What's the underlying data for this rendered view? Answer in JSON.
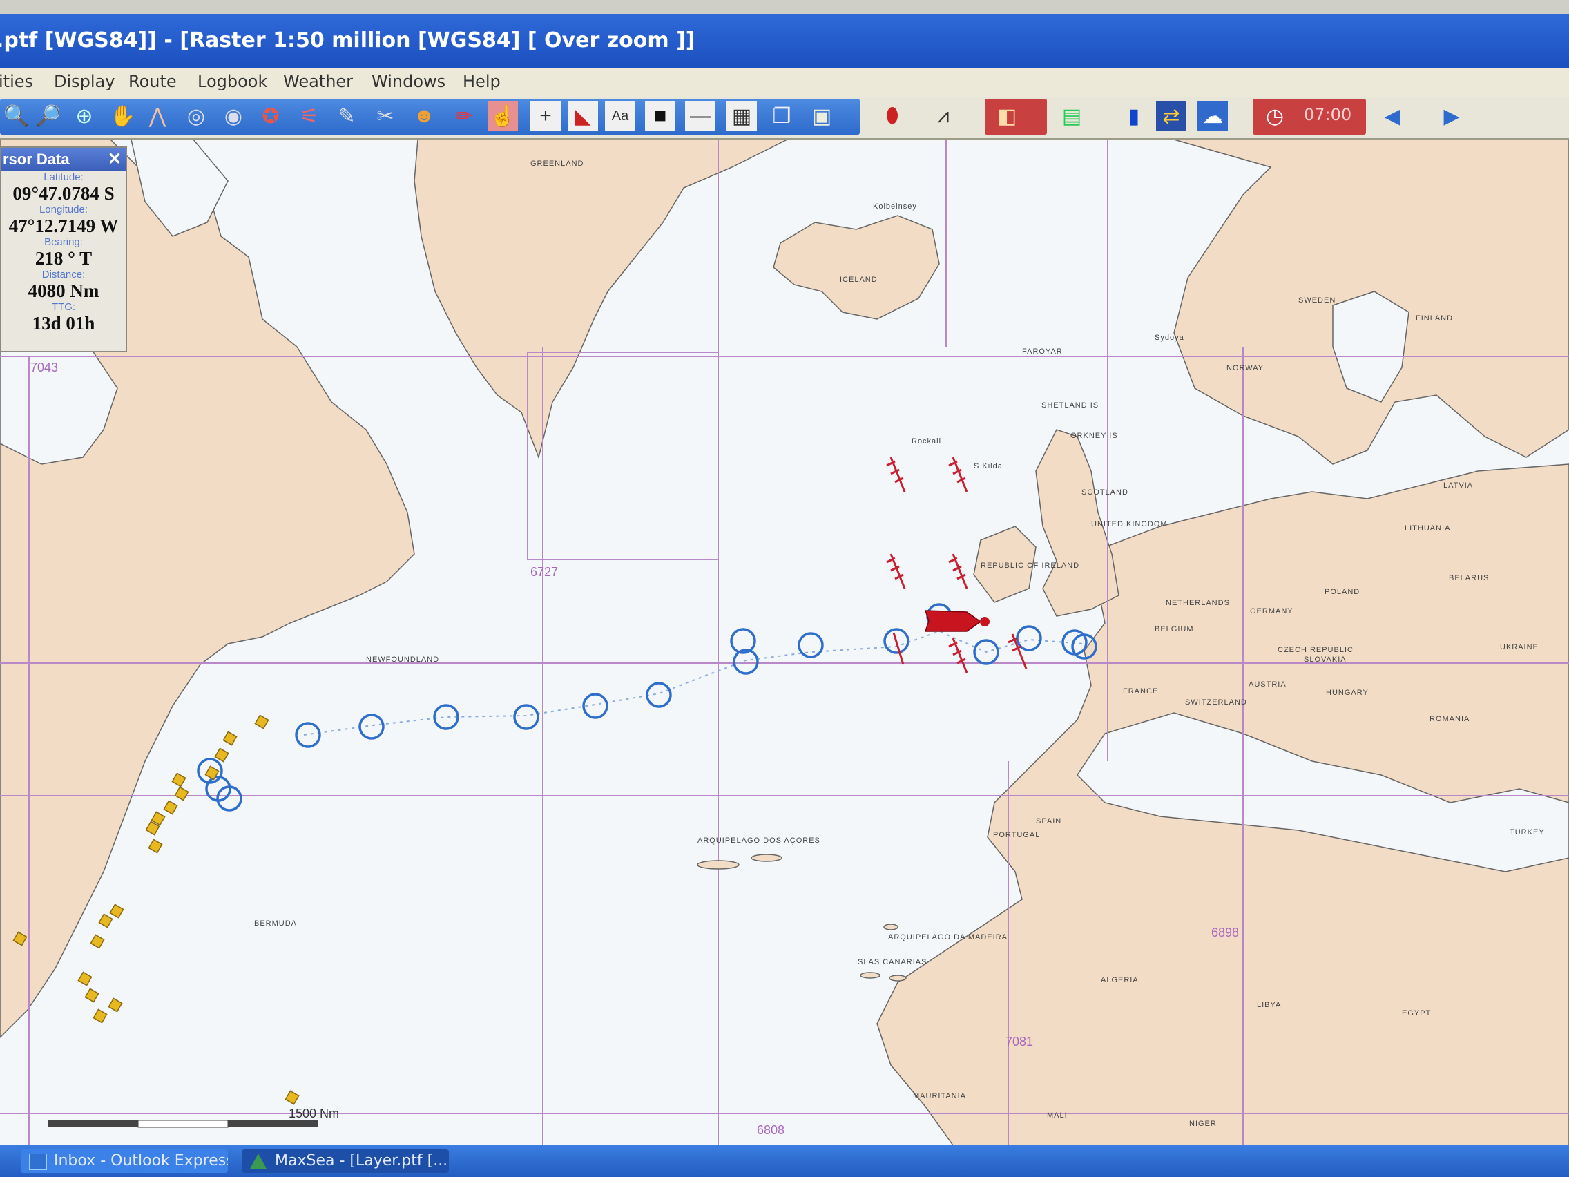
{
  "window": {
    "title": ".ptf [WGS84]] - [Raster 1:50 million [WGS84] [ Over zoom ]]"
  },
  "menu": {
    "items": [
      "ities",
      "Display",
      "Route",
      "Logbook",
      "Weather",
      "Windows",
      "Help"
    ]
  },
  "toolbar": {
    "time": "07:00"
  },
  "cursor_data": {
    "title": "rsor Data",
    "close": "✕",
    "latitude_label": "Latitude:",
    "latitude": "09°47.0784 S",
    "longitude_label": "Longitude:",
    "longitude": "47°12.7149 W",
    "bearing_label": "Bearing:",
    "bearing": "218 ° T",
    "distance_label": "Distance:",
    "distance": "4080 Nm",
    "ttg_label": "TTG:",
    "ttg": "13d 01h"
  },
  "map": {
    "scale_label": "1500 Nm",
    "chart_numbers": [
      "7043",
      "6727",
      "6898",
      "6898",
      "7081",
      "6808"
    ],
    "labels": {
      "greenland": "GREENLAND",
      "iceland": "ICELAND",
      "norway": "NORWAY",
      "sweden": "SWEDEN",
      "finland": "FINLAND",
      "faroe": "FAROYAR",
      "shetland": "SHETLAND IS",
      "orkney": "ORKNEY IS",
      "scotland": "SCOTLAND",
      "uk": "UNITED KINGDOM",
      "ireland": "REPUBLIC OF IRELAND",
      "netherlands": "NETHERLANDS",
      "belgium": "BELGIUM",
      "germany": "GERMANY",
      "poland": "POLAND",
      "belarus": "BELARUS",
      "ukraine": "UKRAINE",
      "latvia": "LATVIA",
      "lithuania": "LITHUANIA",
      "france": "FRANCE",
      "switzerland": "SWITZERLAND",
      "austria": "AUSTRIA",
      "slovakia": "SLOVAKIA",
      "hungary": "HUNGARY",
      "romania": "ROMANIA",
      "czech": "CZECH REPUBLIC",
      "spain": "SPAIN",
      "portugal": "PORTUGAL",
      "algeria": "ALGERIA",
      "libya": "LIBYA",
      "egypt": "EGYPT",
      "turkey": "TURKEY",
      "mauritania": "MAURITANIA",
      "mali": "MALI",
      "niger": "NIGER",
      "azores": "ARQUIPELAGO DOS AÇORES",
      "madeira": "ARQUIPELAGO DA MADEIRA",
      "canarias": "ISLAS CANARIAS",
      "newfoundland": "NEWFOUNDLAND",
      "bermuda": "BERMUDA",
      "kolbeinsey": "Kolbeinsey",
      "rockall": "Rockall",
      "stkilda": "S Kilda",
      "syd": "Sydoya"
    }
  },
  "taskbar": {
    "items": [
      "Inbox - Outlook Express",
      "MaxSea - [Layer.ptf [..."
    ]
  }
}
